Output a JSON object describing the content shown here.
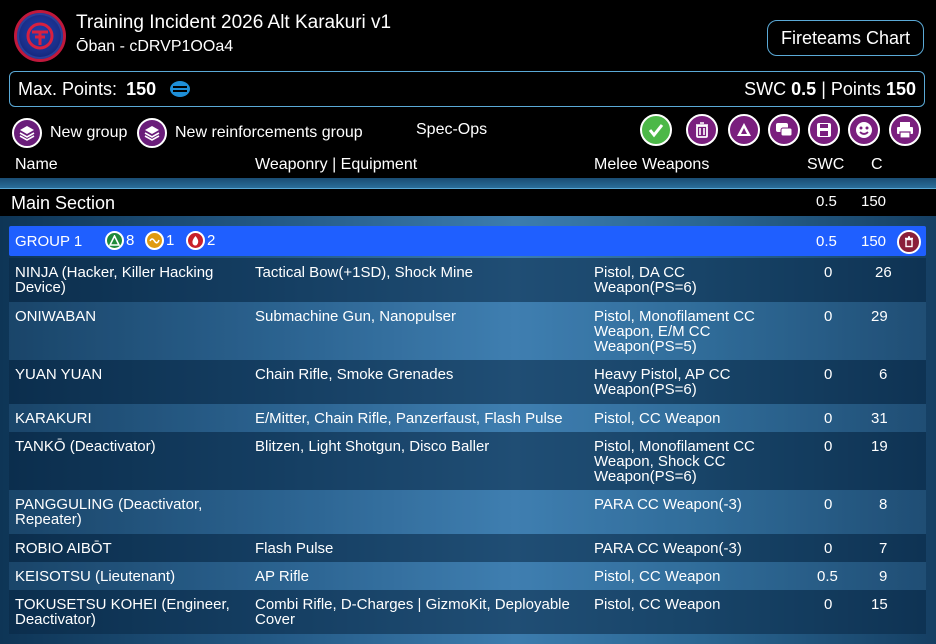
{
  "header": {
    "title": "Training Incident 2026 Alt Karakuri v1",
    "subtitle": "Ōban - cDRVP1OOa4",
    "logo_icon": "oban-faction-logo",
    "fireteams_label": "Fireteams Chart"
  },
  "points_bar": {
    "max_points_label": "Max. Points:",
    "max_points_value": "150",
    "swc_label": "SWC",
    "swc_value": "0.5",
    "separator": "|",
    "points_label": "Points",
    "points_value": "150"
  },
  "toolbar": {
    "new_group_label": "New group",
    "new_reinforcements_label": "New reinforcements group",
    "spec_ops_label": "Spec-Ops",
    "actions": [
      "validate-icon",
      "trash-icon",
      "army-icon",
      "chat-icon",
      "save-icon",
      "smile-icon",
      "print-icon"
    ]
  },
  "columns": {
    "name": "Name",
    "weaponry": "Weaponry | Equipment",
    "melee": "Melee Weapons",
    "swc": "SWC",
    "c": "C"
  },
  "main_section": {
    "title": "Main Section",
    "swc": "0.5",
    "c": "150"
  },
  "group": {
    "label": "GROUP 1",
    "regular_count": "8",
    "irregular_count": "1",
    "impetuous_count": "2",
    "swc": "0.5",
    "c": "150"
  },
  "units": [
    {
      "name": "NINJA (Hacker, Killer Hacking Device)",
      "weapons": "Tactical Bow(+1SD), Shock Mine",
      "melee": "Pistol, DA CC Weapon(PS=6)",
      "swc": "0",
      "c": "26"
    },
    {
      "name": "ONIWABAN",
      "weapons": "Submachine Gun, Nanopulser",
      "melee": "Pistol, Monofilament CC Weapon, E/M CC Weapon(PS=5)",
      "swc": "0",
      "c": "29"
    },
    {
      "name": "YUAN YUAN",
      "weapons": "Chain Rifle, Smoke Grenades",
      "melee": "Heavy Pistol, AP CC Weapon(PS=6)",
      "swc": "0",
      "c": "6"
    },
    {
      "name": "KARAKURI",
      "weapons": "E/Mitter, Chain Rifle, Panzerfaust, Flash Pulse",
      "melee": "Pistol, CC Weapon",
      "swc": "0",
      "c": "31"
    },
    {
      "name": "TANKŌ (Deactivator)",
      "weapons": "Blitzen, Light Shotgun, Disco Baller",
      "melee": "Pistol, Monofilament CC Weapon, Shock CC Weapon(PS=6)",
      "swc": "0",
      "c": "19"
    },
    {
      "name": "PANGGULING (Deactivator, Repeater)",
      "weapons": "",
      "melee": "PARA CC Weapon(-3)",
      "swc": "0",
      "c": "8"
    },
    {
      "name": "ROBIO AIBŌT",
      "weapons": "Flash Pulse",
      "melee": "PARA CC Weapon(-3)",
      "swc": "0",
      "c": "7"
    },
    {
      "name": "KEISOTSU (Lieutenant)",
      "weapons": "AP Rifle",
      "melee": "Pistol, CC Weapon",
      "swc": "0.5",
      "c": "9"
    },
    {
      "name": "TOKUSETSU KOHEI (Engineer, Deactivator)",
      "weapons": "Combi Rifle, D-Charges | GizmoKit, Deployable Cover",
      "melee": "Pistol, CC Weapon",
      "swc": "0",
      "c": "15"
    }
  ]
}
